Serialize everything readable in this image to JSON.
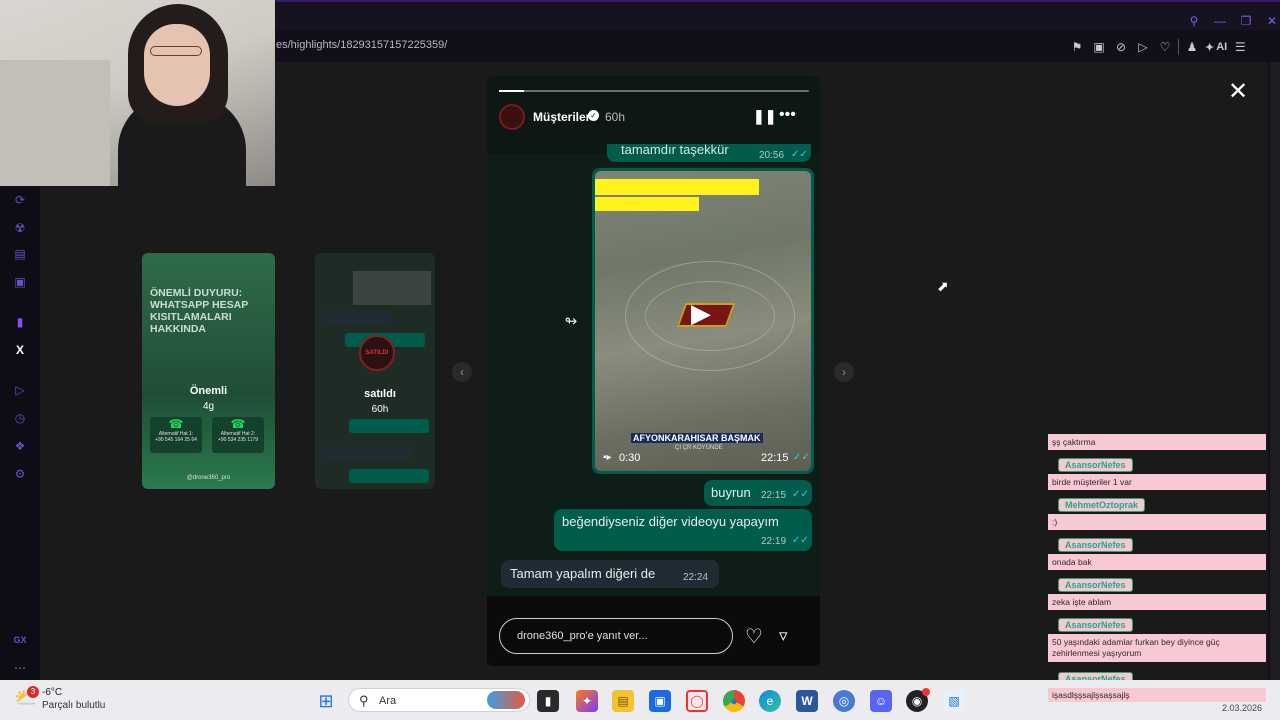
{
  "browser": {
    "url": "es/highlights/18293157157225359/",
    "ai_label": "AI"
  },
  "story": {
    "username": "Müşteriler",
    "time_ago": "60h",
    "top_message_partial": "tamamdır taşekkür",
    "top_message_time": "20:56",
    "video": {
      "caption": "AFYONKARAHISAR BAŞMAK",
      "caption_small": "ÇI  ÇR KÖYÜNDE",
      "duration": "0:30",
      "time": "22:15"
    },
    "messages": [
      {
        "dir": "out",
        "text": "buyrun",
        "time": "22:15"
      },
      {
        "dir": "out",
        "text": "beğendiyseniz diğer videoyu yapayım",
        "time": "22:19"
      },
      {
        "dir": "in",
        "text": "Tamam yapalım diğeri de",
        "time": "22:24"
      }
    ],
    "reply_placeholder": "drone360_pro'e yanıt ver..."
  },
  "thumbs": [
    {
      "heading": "ÖNEMLİ DUYURU: WHATSAPP HESAP KISITLAMALARI HAKKINDA",
      "label": "Önemli",
      "time": "4g",
      "line1": "Alternatif Hat 1:",
      "phone1": "+90 545 164 25 64",
      "line2": "Alternatif Hat 2:",
      "phone2": "+90 534 235 1179",
      "footer": "@drone360_pro"
    },
    {
      "label": "satıldı",
      "time": "60h",
      "badge": "SATILDI"
    }
  ],
  "chat": [
    {
      "user": "",
      "text": "şş çaktırma"
    },
    {
      "user": "AsansorNefes",
      "text": "birde müşteriler 1 var"
    },
    {
      "user": "MehmetOztoprak",
      "text": ":)"
    },
    {
      "user": "AsansorNefes",
      "text": "onada bak"
    },
    {
      "user": "AsansorNefes",
      "text": "zeka işte ablam"
    },
    {
      "user": "AsansorNefes",
      "text": "50 yaşındaki adamlar furkan bey diyince güç zehirlenmesi yaşıyorum"
    },
    {
      "user": "AsansorNefes",
      "text": "işasdlşşsajlşsaşsajlş"
    }
  ],
  "taskbar": {
    "weather_temp": "-6°C",
    "weather_desc": "Parçalı bulutlu",
    "weather_badge": "3",
    "search_label": "Ara",
    "date_partial": "2.03.2026"
  },
  "colors": {
    "whatsapp_out": "#005c4b",
    "whatsapp_in": "#1f2c33",
    "tick_blue": "#53bdeb",
    "chat_pink": "#f8c8d4",
    "highlight_yellow": "#fff21e"
  }
}
